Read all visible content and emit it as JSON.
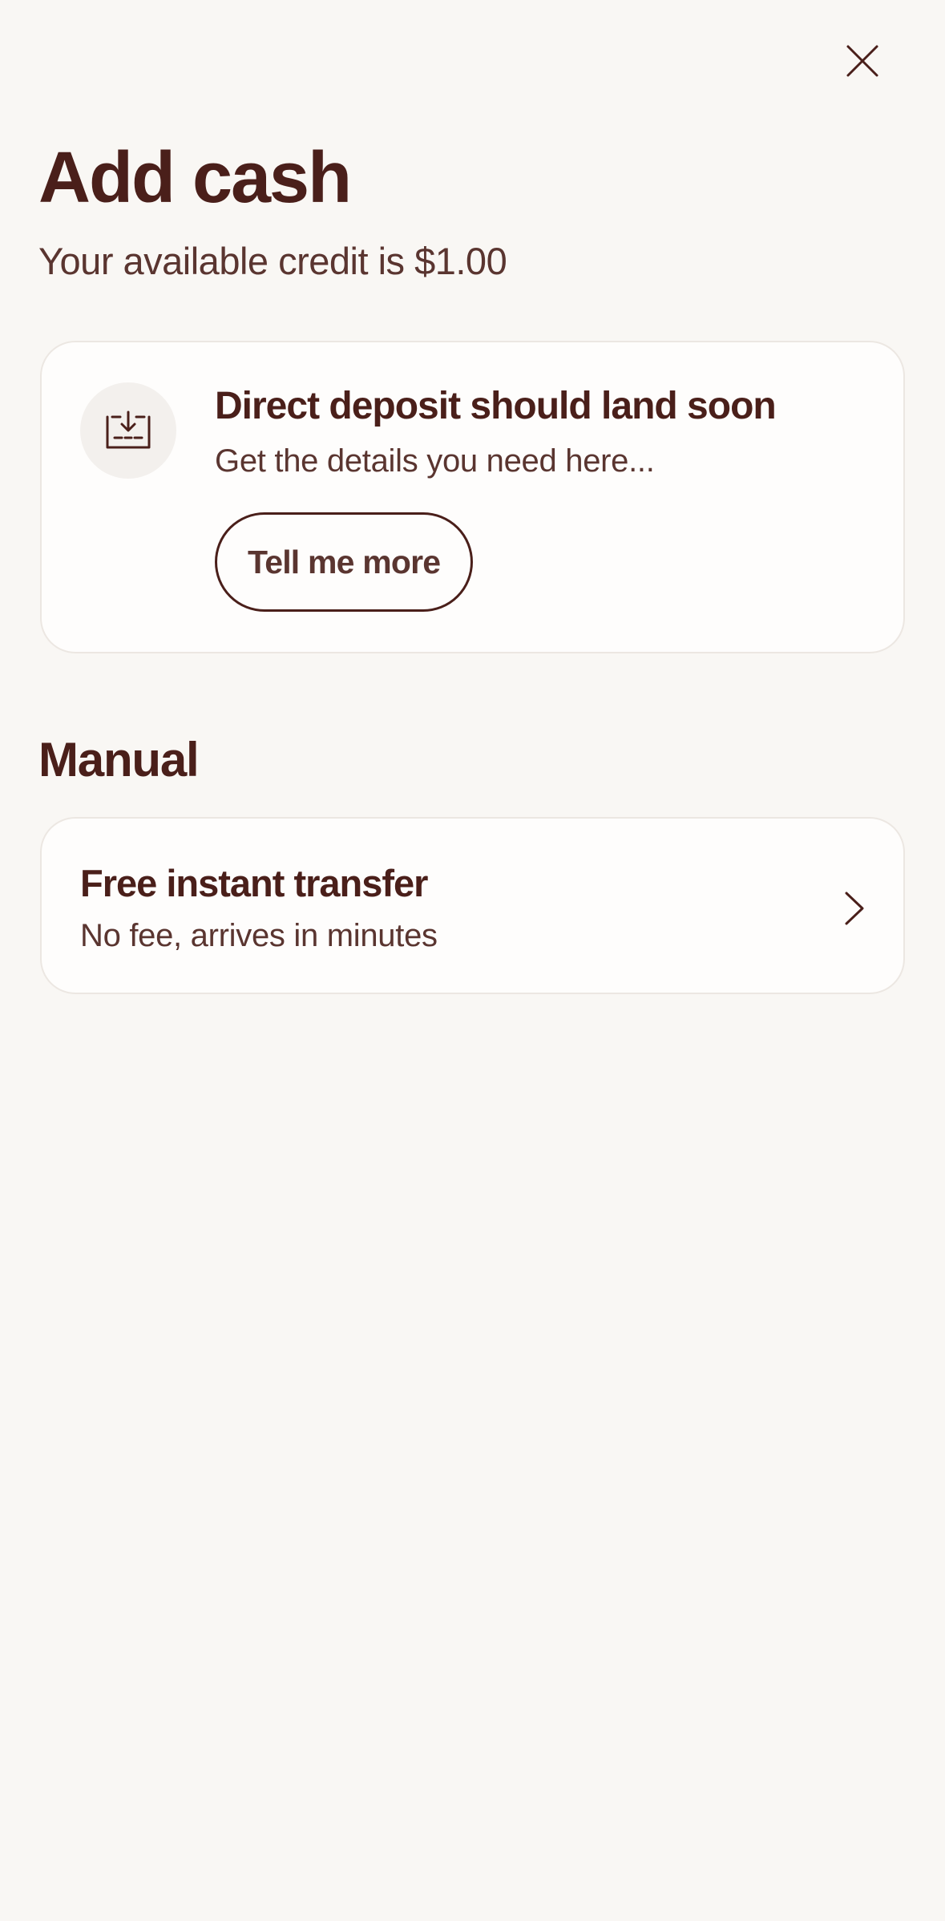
{
  "header": {
    "close_icon": "close-icon",
    "title": "Add cash",
    "credit_text": "Your available credit is $1.00"
  },
  "deposit_card": {
    "icon": "download-tray-icon",
    "title": "Direct deposit should land soon",
    "subtitle": "Get the details you need here...",
    "button_label": "Tell me more"
  },
  "manual": {
    "heading": "Manual",
    "items": [
      {
        "title": "Free instant transfer",
        "subtitle": "No fee, arrives in minutes",
        "icon": "chevron-right-icon"
      }
    ]
  },
  "colors": {
    "background": "#F9F7F4",
    "card": "#FEFDFC",
    "text_primary": "#4A1F1A",
    "text_secondary": "#5A3530",
    "border": "#ECE7E2"
  }
}
